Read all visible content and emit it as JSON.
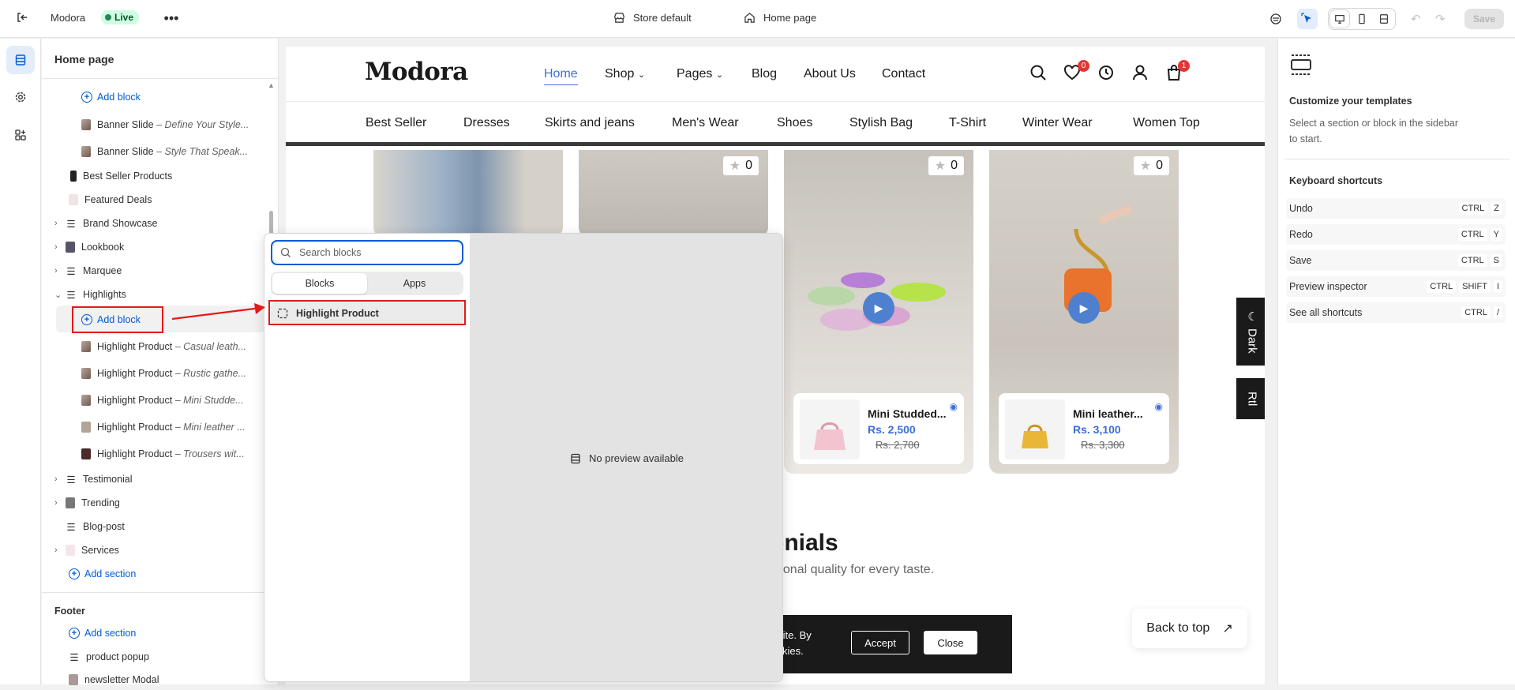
{
  "topbar": {
    "store_name": "Modora",
    "live_label": "Live",
    "more_icon": "more-horizontal-icon",
    "store_selector": "Store default",
    "page_selector": "Home page",
    "save_label": "Save"
  },
  "sidebar": {
    "title": "Home page",
    "rows": {
      "add_block_top": "Add block",
      "banner1_name": "Banner Slide",
      "banner1_sub": "– Define Your Style...",
      "banner2_name": "Banner Slide",
      "banner2_sub": "– Style That Speak...",
      "best_seller": "Best Seller Products",
      "featured": "Featured Deals",
      "brand": "Brand Showcase",
      "lookbook": "Lookbook",
      "marquee": "Marquee",
      "highlights": "Highlights",
      "add_block_highlights": "Add block",
      "hp1_name": "Highlight Product",
      "hp1_sub": "– Casual leath...",
      "hp2_name": "Highlight Product",
      "hp2_sub": "– Rustic gathe...",
      "hp3_name": "Highlight Product",
      "hp3_sub": "– Mini Studde...",
      "hp4_name": "Highlight Product",
      "hp4_sub": "– Mini leather ...",
      "hp5_name": "Highlight Product",
      "hp5_sub": "– Trousers wit...",
      "testimonial": "Testimonial",
      "trending": "Trending",
      "blog": "Blog-post",
      "services": "Services",
      "add_section": "Add section"
    },
    "footer": {
      "label": "Footer",
      "add_section": "Add section",
      "product_popup": "product popup",
      "newsletter": "newsletter Modal"
    }
  },
  "popover": {
    "search_placeholder": "Search blocks",
    "tabs": [
      "Blocks",
      "Apps"
    ],
    "block_item": "Highlight Product",
    "no_preview": "No preview available"
  },
  "preview": {
    "brand": "Modora",
    "nav": [
      "Home",
      "Shop",
      "Pages",
      "Blog",
      "About Us",
      "Contact"
    ],
    "wishlist_count": "0",
    "cart_count": "1",
    "categories": [
      "Best Seller",
      "Dresses",
      "Skirts and jeans",
      "Men's Wear",
      "Shoes",
      "Stylish Bag",
      "T-Shirt",
      "Winter Wear",
      "Women Top"
    ],
    "star_counts": [
      "0",
      "0",
      "0"
    ],
    "products": [
      {
        "name": "Mini Studded...",
        "price": "Rs. 2,500",
        "old": "Rs. 2,700"
      },
      {
        "name": "Mini leather...",
        "price": "Rs. 3,100",
        "old": "Rs. 3,300"
      }
    ],
    "section_title": "onials",
    "section_sub": "ptional quality for every taste.",
    "dark_tab": "Dark",
    "rtl_tab": "Rtl",
    "cookie_text_1": "ur site. By",
    "cookie_text_2": "cookies.",
    "accept": "Accept",
    "close": "Close",
    "back_to_top": "Back to top"
  },
  "rpanel": {
    "title": "Customize your templates",
    "desc": "Select a section or block in the sidebar to start.",
    "shortcuts_title": "Keyboard shortcuts",
    "shortcuts": [
      {
        "label": "Undo",
        "keys": [
          "CTRL",
          "Z"
        ]
      },
      {
        "label": "Redo",
        "keys": [
          "CTRL",
          "Y"
        ]
      },
      {
        "label": "Save",
        "keys": [
          "CTRL",
          "S"
        ]
      },
      {
        "label": "Preview inspector",
        "keys": [
          "CTRL",
          "SHIFT",
          "I"
        ]
      },
      {
        "label": "See all shortcuts",
        "keys": [
          "CTRL",
          "/"
        ]
      }
    ]
  },
  "colors": {
    "accent": "#005bd3",
    "annotation_red": "#e21a1a",
    "store_blue": "#3d6dd8"
  }
}
